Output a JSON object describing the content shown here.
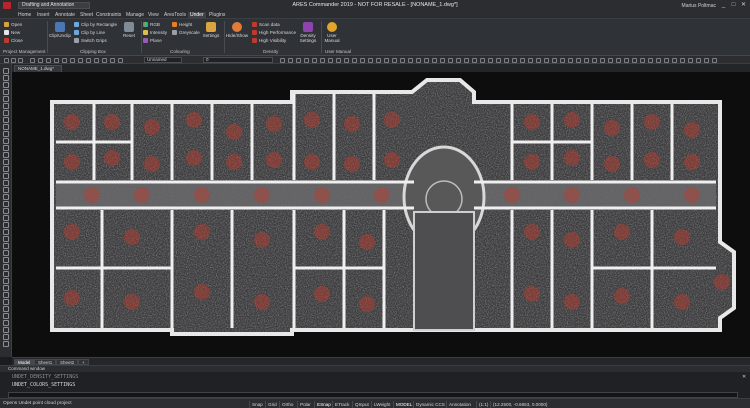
{
  "titlebar": {
    "workspace": "Drafting and Annotation",
    "title": "ARES Commander 2019 - NOT FOR RESALE - [NONAME_1.dwg*]",
    "user": "Marius Poltmac",
    "controls": [
      "_",
      "□",
      "✕"
    ]
  },
  "menu": {
    "items": [
      "Home",
      "Insert",
      "Annotate",
      "Sheet",
      "Constraints",
      "Manage",
      "View",
      "AresTools",
      "Under",
      "Plugins"
    ],
    "active_index": 8
  },
  "ribbon": {
    "project": {
      "items": [
        "Open",
        "New",
        "Close"
      ],
      "label": "Project Management"
    },
    "clipping": {
      "big": "Clip/Unclip",
      "items": [
        "Clip by Rectangle",
        "Clip by Line",
        "Switch Grips"
      ],
      "label": "Clipping Box"
    },
    "reset": "Reset",
    "colouring": {
      "items": [
        "RGB",
        "Intensity",
        "Plane",
        "Height",
        "Greyscale"
      ],
      "big": "Settings",
      "label": "Colouring"
    },
    "density": {
      "hide": "Hide/Show",
      "items": [
        "Scan data",
        "High Performance",
        "High Visibility"
      ],
      "big": "Density Settings",
      "label": "Density"
    },
    "manual": {
      "big": "User Manual",
      "label": "User Manual"
    }
  },
  "toolbar": {
    "layer_combo": "Unnamed",
    "layer_combo2": "0"
  },
  "doc": {
    "tab": "NONAME_1.dwg*"
  },
  "layout_tabs": [
    "Model",
    "Sheet1",
    "Sheet2",
    "+"
  ],
  "cmd": {
    "header": "Command window",
    "lines": [
      "UNDET_DENSITY_SETTINGS",
      "UNDET_COLORS_SETTINGS"
    ]
  },
  "status": {
    "message": "Opens Undet point cloud project",
    "buttons": [
      "Snap",
      "Grid",
      "Ortho",
      "Polar",
      "ESnap",
      "ETrack",
      "QInput",
      "LWeight",
      "MODEL",
      "Dynamic CCS",
      "Annotation"
    ],
    "scale": "(1:1)",
    "coords": "(12.2500, -0.6653, 0.0000)"
  },
  "colors": {
    "accent_red": "#c0392b",
    "ribbon_bg": "#2f3236",
    "canvas_bg": "#0d0d0e"
  }
}
